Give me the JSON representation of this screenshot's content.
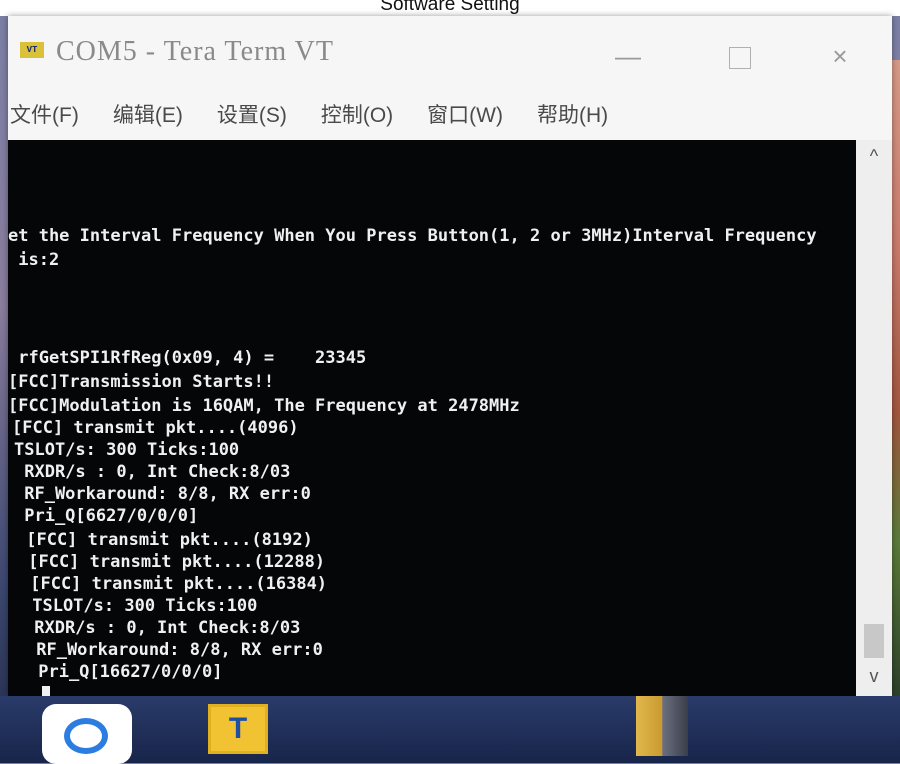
{
  "caption": "Software Setting",
  "window": {
    "app_icon_text": "VT",
    "title": "COM5 - Tera Term VT",
    "controls": {
      "minimize": "—",
      "maximize": "",
      "close": "×"
    }
  },
  "menu": {
    "items": [
      {
        "label": "文件(F)"
      },
      {
        "label": "编辑(E)"
      },
      {
        "label": "设置(S)"
      },
      {
        "label": "控制(O)"
      },
      {
        "label": "窗口(W)"
      },
      {
        "label": "帮助(H)"
      }
    ]
  },
  "terminal": {
    "lines": [
      "et the Interval Frequency When You Press Button(1, 2 or 3MHz)Interval Frequency",
      " is:2",
      " rfGetSPI1RfReg(0x09, 4) =    23345",
      "[FCC]Transmission Starts!!",
      "[FCC]Modulation is 16QAM, The Frequency at 2478MHz",
      "[FCC] transmit pkt....(4096)",
      "TSLOT/s: 300 Ticks:100",
      " RXDR/s : 0, Int Check:8/03",
      " RF_Workaround: 8/8, RX err:0",
      " Pri_Q[6627/0/0/0]",
      " [FCC] transmit pkt....(8192)",
      " [FCC] transmit pkt....(12288)",
      " [FCC] transmit pkt....(16384)",
      " TSLOT/s: 300 Ticks:100",
      " RXDR/s : 0, Int Check:8/03",
      " RF_Workaround: 8/8, RX err:0",
      " Pri_Q[16627/0/0/0]"
    ]
  },
  "scrollbar": {
    "up": "^",
    "down": "v"
  },
  "taskbar": {
    "icon2_text": "T"
  }
}
